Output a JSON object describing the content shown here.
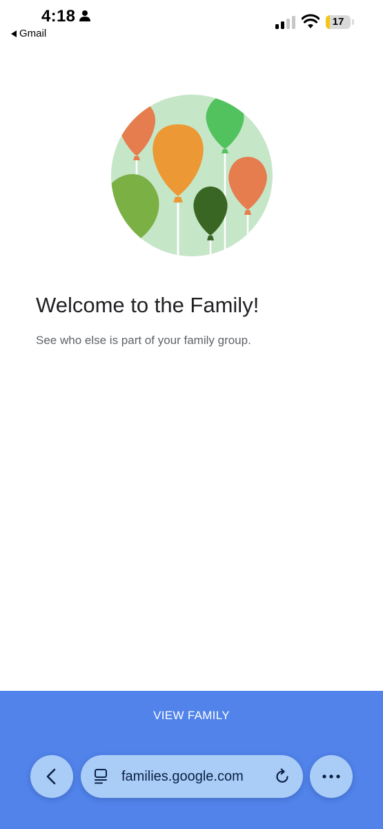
{
  "status_bar": {
    "time": "4:18",
    "back_app": "Gmail",
    "battery_level": "17",
    "battery_fraction": 0.17,
    "icons": [
      "person-icon",
      "cellular-signal-icon",
      "wifi-icon",
      "battery-icon"
    ]
  },
  "welcome": {
    "title": "Welcome to the Family!",
    "subtitle": "See who else is part of your family group."
  },
  "bottom_bar": {
    "view_family_label": "VIEW FAMILY"
  },
  "browser": {
    "url": "families.google.com",
    "icons": [
      "chevron-left-icon",
      "page-menu-icon",
      "reload-icon",
      "more-icon"
    ]
  },
  "colors": {
    "bottom_bar": "#5183ea",
    "toolbar_button": "#a9cdf7",
    "illustration_background": "#c6e6c8",
    "balloon_orange": "#e57d4f",
    "balloon_amber": "#ec9935",
    "balloon_green": "#52c25e",
    "balloon_olive": "#7bb045",
    "balloon_dark_green": "#3a6624"
  }
}
